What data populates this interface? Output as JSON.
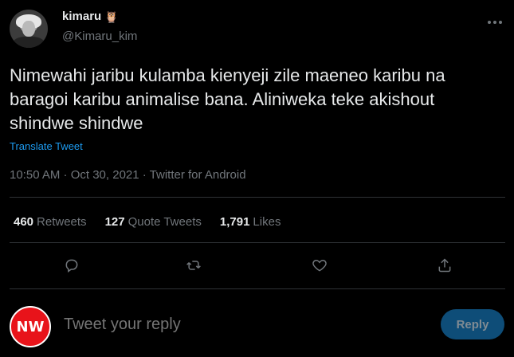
{
  "author": {
    "display_name": "kimaru",
    "emoji": "🦉",
    "handle": "@Kimaru_kim"
  },
  "tweet": {
    "text": "Nimewahi jaribu kulamba kienyeji zile maeneo karibu na baragoi karibu animalise bana. Aliniweka teke akishout shindwe shindwe",
    "translate_label": "Translate Tweet",
    "meta": "10:50 AM · Oct 30, 2021 · Twitter for Android"
  },
  "stats": [
    {
      "count": "460",
      "label": "Retweets"
    },
    {
      "count": "127",
      "label": "Quote Tweets"
    },
    {
      "count": "1,791",
      "label": "Likes"
    }
  ],
  "actions": {
    "reply_icon": "reply-icon",
    "retweet_icon": "retweet-icon",
    "like_icon": "heart-icon",
    "share_icon": "share-icon"
  },
  "composer": {
    "avatar_text": "NW",
    "placeholder": "Tweet your reply",
    "button_label": "Reply"
  },
  "colors": {
    "background": "#000000",
    "accent": "#1d9bf0",
    "muted": "#71767b",
    "reply_button": "#0e4d78",
    "avatar_red": "#e8131a"
  }
}
